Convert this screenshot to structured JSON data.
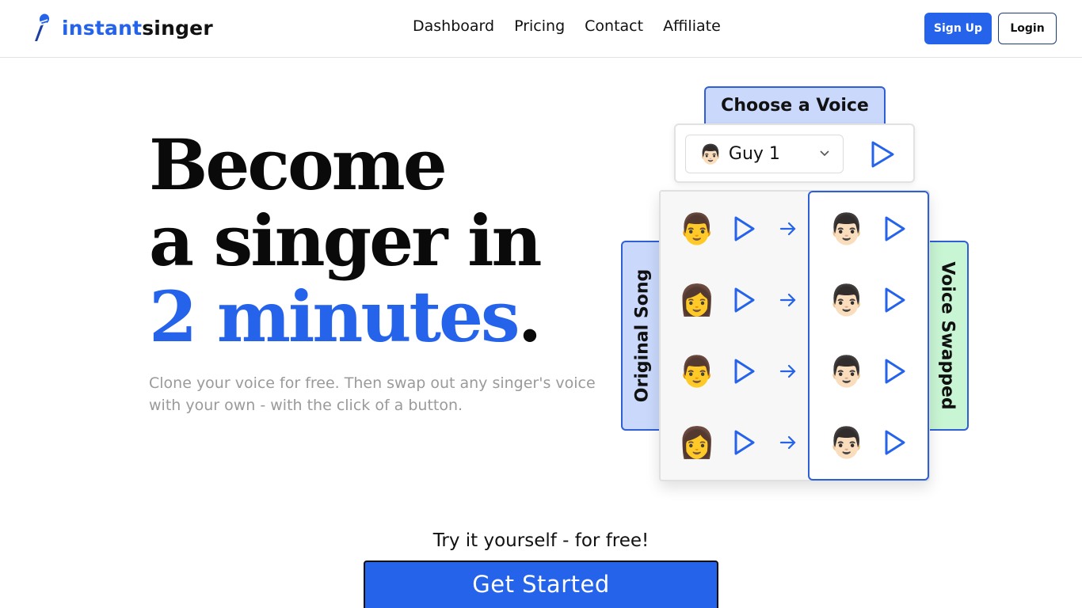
{
  "brand": {
    "name_part1": "instant",
    "name_part2": "singer",
    "colors": {
      "primary": "#2563eb",
      "dark": "#111111",
      "muted": "#9a9a9a",
      "tab_blue": "#c9d8fb",
      "tab_green": "#c8f5d3"
    }
  },
  "nav": {
    "links": [
      "Dashboard",
      "Pricing",
      "Contact",
      "Affiliate"
    ],
    "signup": "Sign Up",
    "login": "Login"
  },
  "hero": {
    "line1": "Become",
    "line2": "a singer in",
    "line3_blue": "2 minutes",
    "line3_dot": ".",
    "subtitle": "Clone your voice for free. Then swap out any singer's voice with your own - with the click of a button."
  },
  "widget": {
    "choose_label": "Choose a Voice",
    "selected_voice": {
      "emoji": "👨🏻",
      "name": "Guy 1"
    },
    "original_label": "Original Song",
    "swapped_label": "Voice Swapped",
    "rows": [
      {
        "original": "👨",
        "swapped": "👨🏻"
      },
      {
        "original": "👩",
        "swapped": "👨🏻"
      },
      {
        "original": "👨",
        "swapped": "👨🏻"
      },
      {
        "original": "👩",
        "swapped": "👨🏻"
      }
    ],
    "icons": {
      "play": "play-icon",
      "arrow": "arrow-right-icon",
      "chevron": "chevron-down-icon"
    }
  },
  "cta": {
    "prompt": "Try it yourself - for free!",
    "button": "Get Started"
  }
}
